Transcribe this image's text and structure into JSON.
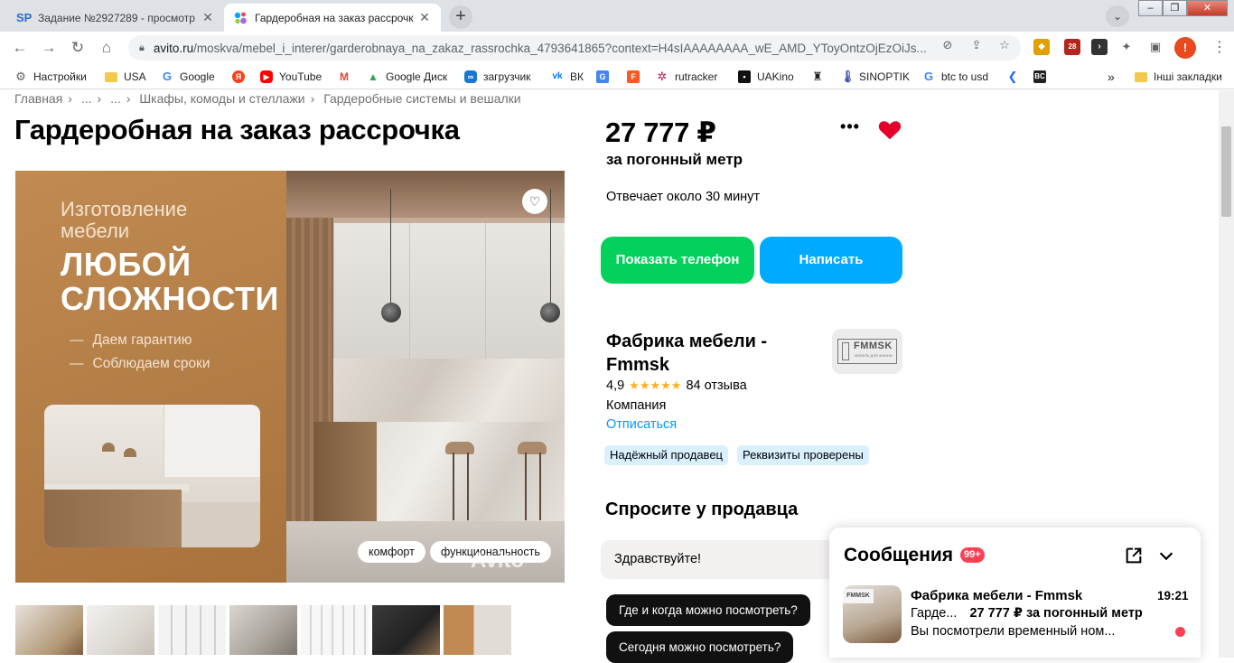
{
  "browser": {
    "tabs": [
      {
        "title": "Задание №2927289 - просмотр",
        "active": false,
        "favicon": "SP"
      },
      {
        "title": "Гардеробная на заказ рассрочк",
        "active": true,
        "favicon": "avito-dots-icon"
      }
    ],
    "url_host": "avito.ru",
    "url_path": "/moskva/mebel_i_interer/garderobnaya_na_zakaz_rassrochka_4793641865?context=H4sIAAAAAAAA_wE_AMD_YToyOntzOjEzOiJs...",
    "extension_badge": "28",
    "profile_letter": "!",
    "bookmarks": [
      "Настройки",
      "USA",
      "Google",
      "YouTube",
      "Google Диск",
      "загрузчик",
      "ВК",
      "rutracker",
      "UAKino",
      "SINOPTIK",
      "btc to usd",
      "Інші закладки"
    ],
    "bookmarks_more": "»"
  },
  "breadcrumbs": [
    "Главная",
    "...",
    "...",
    "Шкафы, комоды и стеллажи",
    "Гардеробные системы и вешалки"
  ],
  "listing": {
    "title": "Гардеробная на заказ рассрочка",
    "photo": {
      "promo_small": [
        "Изготовление",
        "мебели"
      ],
      "promo_big": [
        "ЛЮБОЙ",
        "СЛОЖНОСТИ"
      ],
      "promo_points": [
        "Даем гарантию",
        "Соблюдаем сроки"
      ],
      "tags": [
        "комфорт",
        "функциональность"
      ],
      "watermark": "Avito"
    },
    "thumbnail_count": 7,
    "price": "27 777 ₽",
    "price_unit": "за погонный метр",
    "reply_time": "Отвечает около 30 минут",
    "buttons": {
      "phone": "Показать телефон",
      "write": "Написать"
    }
  },
  "seller": {
    "name": "Фабрика мебели - Fmmsk",
    "logo_text": "FMMSK",
    "logo_subtext": "МЕБЕЛЬ ДЛЯ ЖИЗНИ",
    "rating": "4,9",
    "stars": "★★★★★",
    "reviews": "84 отзыва",
    "type": "Компания",
    "unsubscribe": "Отписаться",
    "badges": [
      "Надёжный продавец",
      "Реквизиты проверены"
    ]
  },
  "ask": {
    "title": "Спросите у продавца",
    "input_value": "Здравствуйте!",
    "chips": [
      "Где и когда можно посмотреть?",
      "Сегодня можно посмотреть?"
    ]
  },
  "messenger": {
    "title": "Сообщения",
    "count": "99+",
    "chat": {
      "name": "Фабрика мебели - Fmmsk",
      "time": "19:21",
      "item_short": "Гарде...",
      "price": "27 777 ₽ за погонный метр",
      "preview": "Вы посмотрели временный ном...",
      "avatar_logo": "FMMSK"
    }
  },
  "colors": {
    "green_button": "#02d15c",
    "blue_button": "#00aaff",
    "favorite_heart": "#e4002b",
    "link": "#0099f7",
    "badge_bg": "#d9f0ff",
    "unread": "#ff4053"
  }
}
